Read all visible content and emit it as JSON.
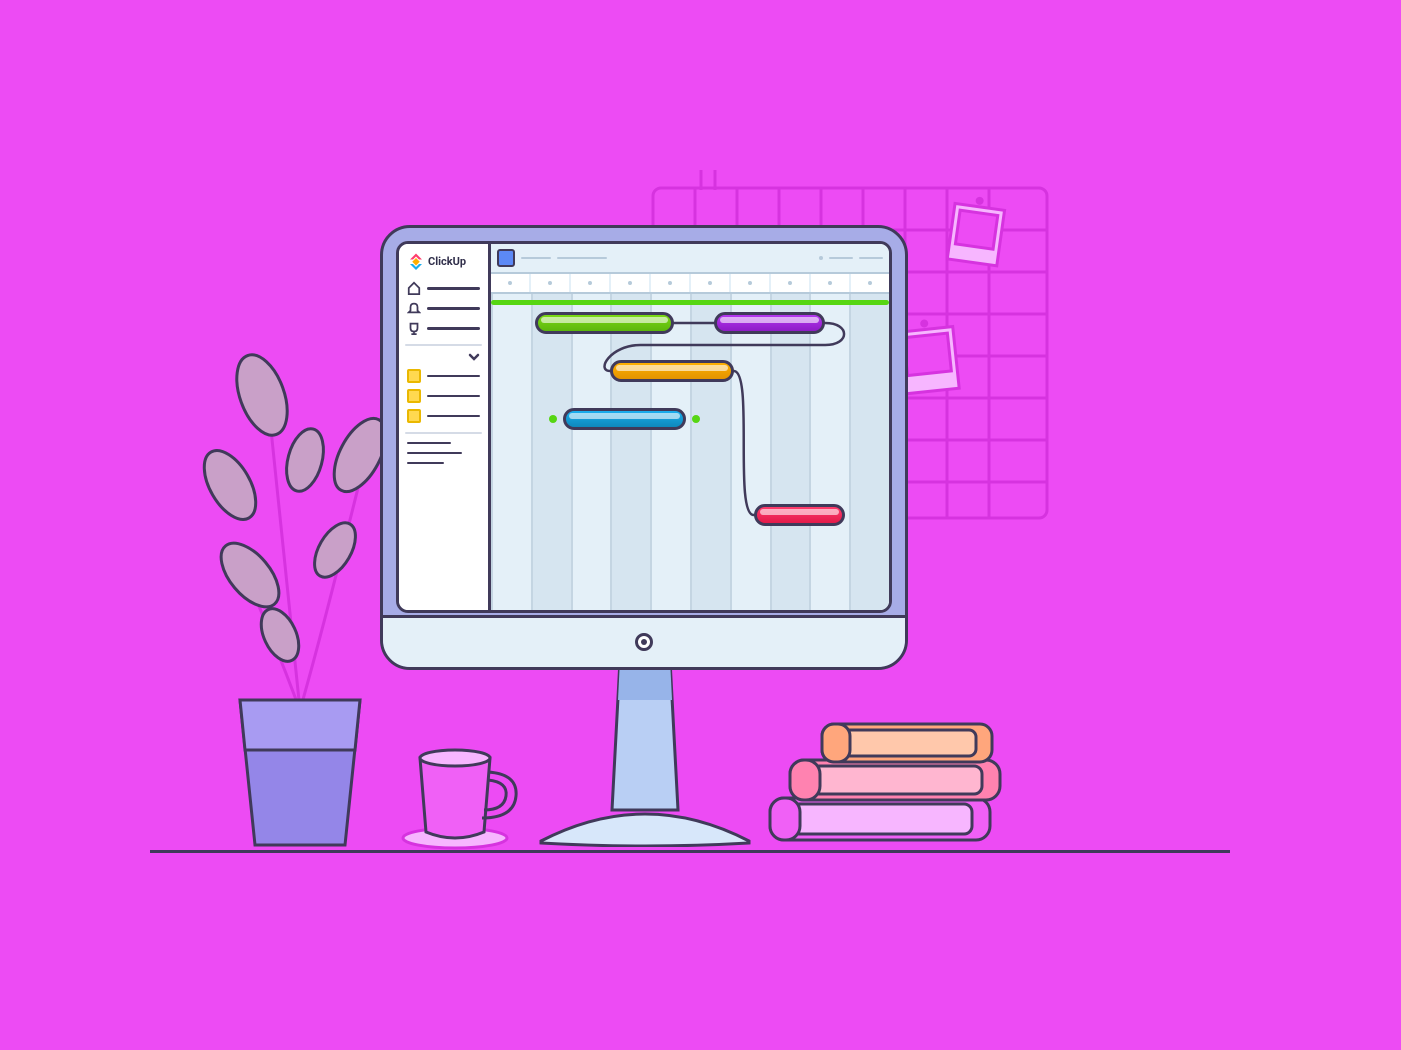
{
  "brand": {
    "name": "ClickUp"
  },
  "sidebar": {
    "nav_items": [
      {
        "icon": "home-icon"
      },
      {
        "icon": "bell-icon"
      },
      {
        "icon": "trophy-icon"
      }
    ],
    "tasks": [
      {
        "color": "yellow"
      },
      {
        "color": "yellow"
      },
      {
        "color": "yellow"
      }
    ]
  },
  "colors": {
    "background": "#ED4BF4",
    "stroke": "#403A5A",
    "screen_bg": "#E4F0F8",
    "green": "#7BD914",
    "purple": "#B437F0",
    "orange": "#FFB000",
    "blue": "#19AEEE",
    "pink": "#FF3C6C"
  },
  "chart_data": {
    "type": "gantt",
    "columns": 10,
    "today_row": 0,
    "bars": [
      {
        "id": "task-1",
        "row": 1,
        "start": 1.1,
        "end": 4.6,
        "color": "#7BD914",
        "shade": "#5CB60C"
      },
      {
        "id": "task-2",
        "row": 1,
        "start": 5.6,
        "end": 8.4,
        "color": "#B437F0",
        "shade": "#8E1BC6"
      },
      {
        "id": "task-3",
        "row": 2,
        "start": 3.0,
        "end": 6.1,
        "color": "#FFB000",
        "shade": "#E39300"
      },
      {
        "id": "task-4",
        "row": 3,
        "start": 1.8,
        "end": 4.9,
        "color": "#19AEEE",
        "shade": "#0F88BC"
      },
      {
        "id": "task-5",
        "row": 5,
        "start": 6.6,
        "end": 8.9,
        "color": "#FF3C6C",
        "shade": "#E31B4A"
      }
    ],
    "milestones": [
      {
        "row": 3,
        "col": 1.55
      },
      {
        "row": 3,
        "col": 5.15
      }
    ],
    "dependencies": [
      {
        "from": "task-1",
        "to": "task-2"
      },
      {
        "from": "task-2",
        "to": "task-3"
      },
      {
        "from": "task-3",
        "to": "task-5"
      }
    ]
  }
}
